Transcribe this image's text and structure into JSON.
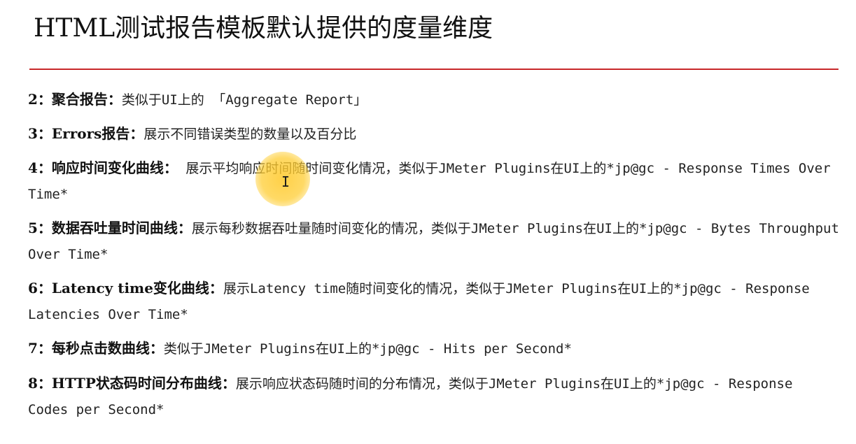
{
  "title": "HTML测试报告模板默认提供的度量维度",
  "colors": {
    "rule": "#c8282a",
    "cursor_highlight": "#ffc828"
  },
  "items": [
    {
      "head": "2：聚合报告：",
      "desc": "类似于UI上的 「Aggregate Report」"
    },
    {
      "head": "3：Errors报告：",
      "desc": "展示不同错误类型的数量以及百分比"
    },
    {
      "head": "4：响应时间变化曲线：",
      "desc": " 展示平均响应时间随时间变化情况，类似于JMeter Plugins在UI上的*jp@gc - Response Times Over Time*"
    },
    {
      "head": "5：数据吞吐量时间曲线：",
      "desc": "展示每秒数据吞吐量随时间变化的情况，类似于JMeter Plugins在UI上的*jp@gc - Bytes Throughput Over Time*"
    },
    {
      "head": "6：Latency time变化曲线：",
      "desc": "展示Latency time随时间变化的情况，类似于JMeter Plugins在UI上的*jp@gc - Response Latencies Over Time*"
    },
    {
      "head": "7：每秒点击数曲线：",
      "desc": "类似于JMeter Plugins在UI上的*jp@gc - Hits per Second*"
    },
    {
      "head": "8：HTTP状态码时间分布曲线：",
      "desc": "展示响应状态码随时间的分布情况，类似于JMeter Plugins在UI上的*jp@gc - Response Codes per Second*"
    }
  ],
  "cursor": {
    "icon": "text-cursor-icon",
    "glyph": "I"
  }
}
